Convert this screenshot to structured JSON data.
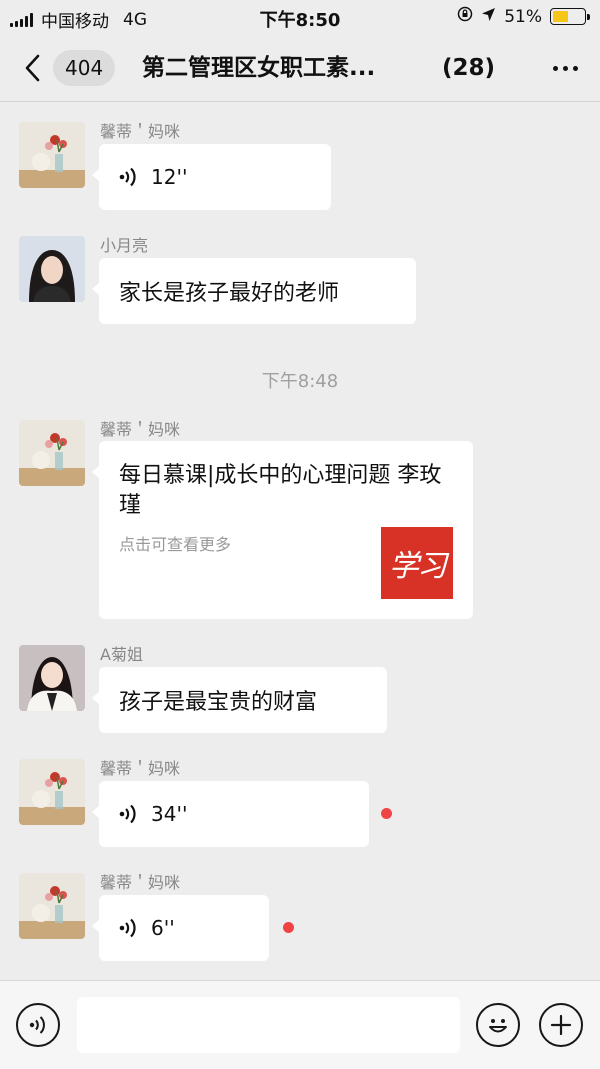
{
  "status_bar": {
    "carrier": "中国移动",
    "network": "4G",
    "time": "下午8:50",
    "battery": "51%",
    "battery_level": 0.51
  },
  "nav": {
    "unread_count": "404",
    "title": "第二管理区女职工素...",
    "member_count": "(28)"
  },
  "messages": [
    {
      "sender": "馨蒂＇妈咪",
      "type": "voice",
      "duration": "12''"
    },
    {
      "sender": "小月亮",
      "type": "text",
      "text": "家长是孩子最好的老师"
    },
    {
      "sender": "馨蒂＇妈咪",
      "type": "link",
      "title": "每日慕课|成长中的心理问题 李玫瑾",
      "desc": "点击可查看更多",
      "thumb_text": "学习"
    },
    {
      "sender": "A菊姐",
      "type": "text",
      "text": "孩子是最宝贵的财富"
    },
    {
      "sender": "馨蒂＇妈咪",
      "type": "voice",
      "duration": "34''",
      "unread": true
    },
    {
      "sender": "馨蒂＇妈咪",
      "type": "voice",
      "duration": "6''",
      "unread": true
    }
  ],
  "time_divider": "下午8:48",
  "input": {
    "placeholder": ""
  },
  "colors": {
    "background": "#ededed",
    "bubble": "#ffffff",
    "unread_dot": "#f04444",
    "thumb": "#d83226"
  }
}
